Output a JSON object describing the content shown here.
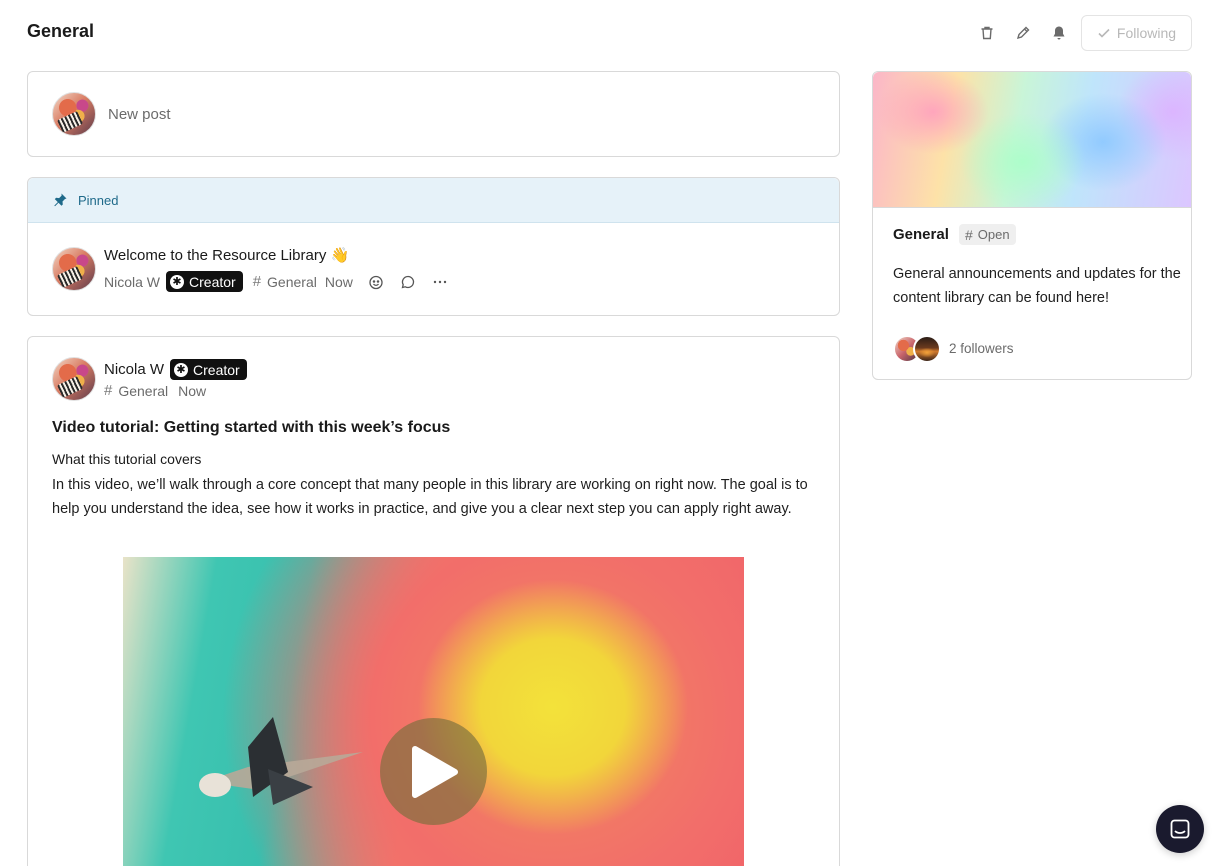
{
  "header": {
    "title": "General",
    "following_label": "Following",
    "icons": [
      "trash-icon",
      "pencil-icon",
      "bell-icon"
    ]
  },
  "composer": {
    "placeholder": "New post"
  },
  "pinned": {
    "label": "Pinned",
    "post": {
      "title": "Welcome to the Resource Library 👋",
      "author": "Nicola W",
      "badge": "Creator",
      "space": "General",
      "time": "Now"
    }
  },
  "post": {
    "author": "Nicola W",
    "badge": "Creator",
    "space": "General",
    "time": "Now",
    "title": "Video tutorial: Getting started with this week’s focus",
    "subheading": "What this tutorial covers",
    "body": "In this video, we’ll walk through a core concept that many people in this library are working on right now. The goal is to help you understand the idea, see how it works in practice, and give you a clear next step you can apply right away."
  },
  "sidebar": {
    "title": "General",
    "status": "Open",
    "description": "General announcements and updates for the content library can be found here!",
    "followers": "2 followers"
  },
  "colors": {
    "pinned_bg": "#e6f2f9",
    "pinned_text": "#1f6a8a",
    "badge_bg": "#111111",
    "chat_button": "#1a1a2e"
  }
}
